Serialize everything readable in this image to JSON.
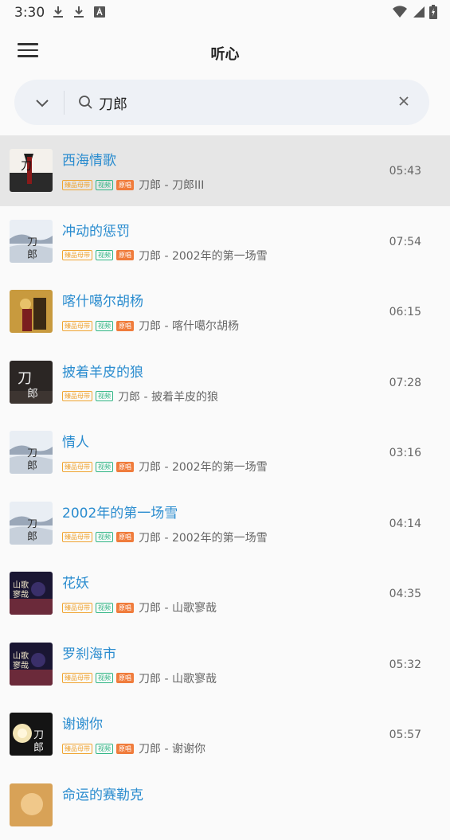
{
  "status": {
    "time": "3:30"
  },
  "app": {
    "title": "听心"
  },
  "search": {
    "value": "刀郎"
  },
  "tag_labels": {
    "quality": "臻品母带",
    "video": "视频",
    "original": "原唱"
  },
  "songs": [
    {
      "title": "西海情歌",
      "artist": "刀郎 - 刀郎III",
      "duration": "05:43",
      "has_original": true,
      "selected": true,
      "cover": "dark-red"
    },
    {
      "title": "冲动的惩罚",
      "artist": "刀郎 - 2002年的第一场雪",
      "duration": "07:54",
      "has_original": true,
      "cover": "snow"
    },
    {
      "title": "喀什噶尔胡杨",
      "artist": "刀郎 - 喀什噶尔胡杨",
      "duration": "06:15",
      "has_original": true,
      "cover": "gold"
    },
    {
      "title": "披着羊皮的狼",
      "artist": "刀郎 - 披着羊皮的狼",
      "duration": "07:28",
      "has_original": false,
      "cover": "dark"
    },
    {
      "title": "情人",
      "artist": "刀郎 - 2002年的第一场雪",
      "duration": "03:16",
      "has_original": true,
      "cover": "snow"
    },
    {
      "title": "2002年的第一场雪",
      "artist": "刀郎 - 2002年的第一场雪",
      "duration": "04:14",
      "has_original": true,
      "cover": "snow"
    },
    {
      "title": "花妖",
      "artist": "刀郎 - 山歌寥哉",
      "duration": "04:35",
      "has_original": true,
      "cover": "night"
    },
    {
      "title": "罗刹海市",
      "artist": "刀郎 - 山歌寥哉",
      "duration": "05:32",
      "has_original": true,
      "cover": "night"
    },
    {
      "title": "谢谢你",
      "artist": "刀郎 - 谢谢你",
      "duration": "05:57",
      "has_original": true,
      "cover": "moon"
    },
    {
      "title": "命运的赛勒克",
      "artist": "",
      "duration": "",
      "has_original": false,
      "cover": "sepia"
    }
  ]
}
